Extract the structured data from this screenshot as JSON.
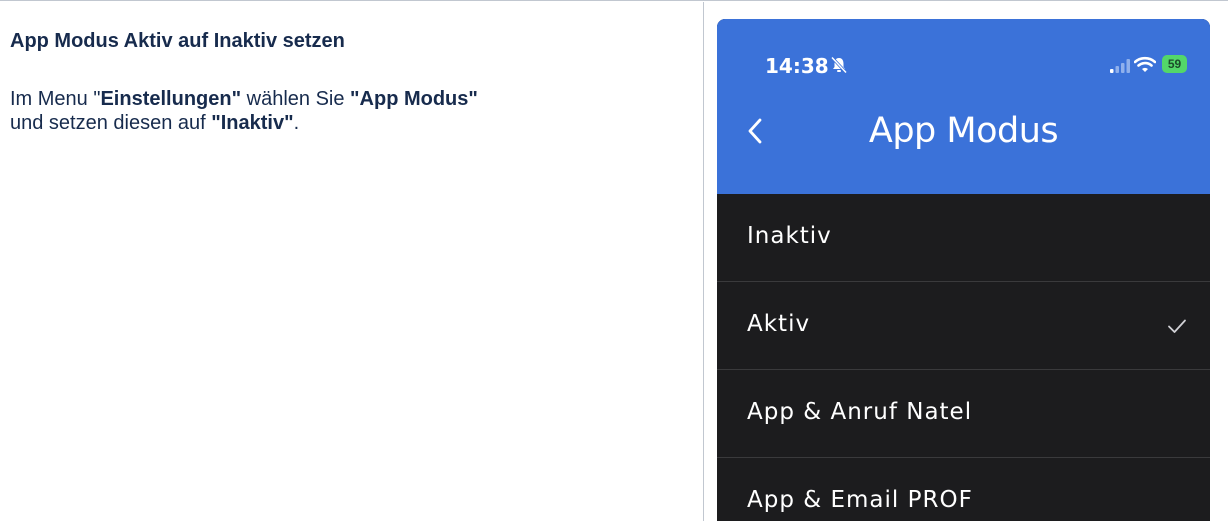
{
  "doc": {
    "heading": "App Modus Aktiv auf Inaktiv setzen",
    "text_1": "Im Menu \"",
    "text_bold_1": "Einstellungen\"",
    "text_2": " wählen Sie ",
    "text_bold_2": "\"App Modus\"",
    "text_3": " und setzen diesen auf ",
    "text_bold_3": "\"Inaktiv\"",
    "text_4": "."
  },
  "phone": {
    "status": {
      "time": "14:38",
      "battery": "59"
    },
    "nav": {
      "title": "App Modus"
    },
    "options": [
      {
        "label": "Inaktiv",
        "selected": false
      },
      {
        "label": "Aktiv",
        "selected": true
      },
      {
        "label": "App & Anruf Natel",
        "selected": false
      },
      {
        "label": "App & Email PROF",
        "selected": false
      }
    ],
    "colors": {
      "header": "#3b72d9",
      "list_background": "#1c1c1e",
      "battery": "#53d769"
    }
  },
  "icons": [
    "bell-slash-icon",
    "signal-icon",
    "wifi-icon",
    "battery-icon",
    "chevron-left-icon",
    "checkmark-icon"
  ]
}
